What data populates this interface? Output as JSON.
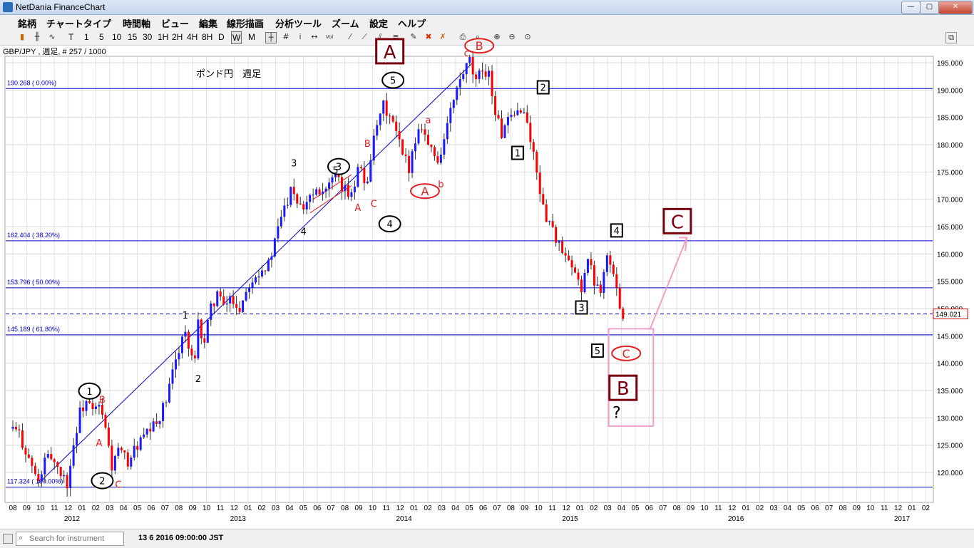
{
  "window": {
    "title": "NetDania FinanceChart",
    "min_label": "—",
    "max_label": "▢",
    "close_label": "✕"
  },
  "menu": [
    "銘柄",
    "チャートタイプ",
    "時間軸",
    "ビュー",
    "編集",
    "線形描画",
    "分析ツール",
    "ズーム",
    "設定",
    "ヘルプ"
  ],
  "toolbar": {
    "periods": [
      "T",
      "1",
      "5",
      "10",
      "15",
      "30",
      "1H",
      "2H",
      "4H",
      "8H",
      "D",
      "W",
      "M"
    ],
    "selected_period": "W"
  },
  "symbol_info": "GBP/JPY , 週足, # 257 / 1000",
  "status": {
    "search_placeholder": "Search for instrument",
    "time": "13 6 2016 09:00:00 JST"
  },
  "colors": {
    "up": "#1a1aff",
    "down": "#ff0000",
    "fib_line": "#0000cc",
    "wave_red": "#e02020",
    "box_dark": "#7a0010",
    "pink": "#f0a0c8"
  },
  "chart_data": {
    "type": "candlestick",
    "title": "ポンド円　週足",
    "instrument": "GBP/JPY",
    "interval": "weekly",
    "ylim": [
      116,
      197
    ],
    "y_ticks": [
      "120.000",
      "125.000",
      "130.000",
      "135.000",
      "140.000",
      "145.000",
      "150.000",
      "155.000",
      "160.000",
      "165.000",
      "170.000",
      "175.000",
      "180.000",
      "185.000",
      "190.000",
      "195.000"
    ],
    "x_months": [
      "08",
      "09",
      "10",
      "11",
      "12",
      "01",
      "02",
      "03",
      "04",
      "05",
      "06",
      "07",
      "08",
      "09",
      "10",
      "11",
      "12",
      "01",
      "02",
      "03",
      "04",
      "05",
      "06",
      "07",
      "08",
      "09",
      "10",
      "11",
      "12",
      "01",
      "02",
      "03",
      "04",
      "05",
      "06",
      "07",
      "08",
      "09",
      "10",
      "11",
      "12",
      "01",
      "02",
      "03",
      "04",
      "05",
      "06",
      "07",
      "08",
      "09",
      "10",
      "11",
      "12",
      "01",
      "02",
      "03",
      "04",
      "05",
      "06",
      "07",
      "08",
      "09",
      "10",
      "11",
      "12",
      "01",
      "02"
    ],
    "x_years": [
      "2012",
      "2013",
      "2014",
      "2015",
      "2016",
      "2017"
    ],
    "x_year_month_index": [
      5,
      17,
      29,
      41,
      53,
      65
    ],
    "last_price": "149.021",
    "path": [
      [
        0,
        128
      ],
      [
        2,
        127
      ],
      [
        4,
        124
      ],
      [
        6,
        121
      ],
      [
        8,
        118
      ],
      [
        10,
        122
      ],
      [
        12,
        123
      ],
      [
        15,
        120
      ],
      [
        17,
        118
      ],
      [
        19,
        125
      ],
      [
        21,
        131
      ],
      [
        23,
        133
      ],
      [
        25,
        131
      ],
      [
        27,
        132
      ],
      [
        29,
        128
      ],
      [
        31,
        121
      ],
      [
        33,
        124
      ],
      [
        36,
        122
      ],
      [
        39,
        125
      ],
      [
        42,
        127
      ],
      [
        45,
        129
      ],
      [
        48,
        133
      ],
      [
        50,
        138
      ],
      [
        52,
        143
      ],
      [
        54,
        146
      ],
      [
        55,
        142
      ],
      [
        57,
        140
      ],
      [
        58,
        147
      ],
      [
        60,
        144
      ],
      [
        62,
        150
      ],
      [
        64,
        153
      ],
      [
        66,
        150
      ],
      [
        68,
        152
      ],
      [
        71,
        150
      ],
      [
        74,
        155
      ],
      [
        77,
        157
      ],
      [
        80,
        158
      ],
      [
        82,
        162
      ],
      [
        84,
        167
      ],
      [
        86,
        170
      ],
      [
        87,
        173
      ],
      [
        89,
        170
      ],
      [
        91,
        169
      ],
      [
        93,
        171
      ],
      [
        95,
        172
      ],
      [
        98,
        172
      ],
      [
        101,
        174
      ],
      [
        103,
        172
      ],
      [
        105,
        171
      ],
      [
        107,
        173
      ],
      [
        108,
        177
      ],
      [
        110,
        173
      ],
      [
        111,
        174
      ],
      [
        112,
        178
      ],
      [
        114,
        183
      ],
      [
        116,
        187
      ],
      [
        118,
        185
      ],
      [
        120,
        182
      ],
      [
        122,
        178
      ],
      [
        124,
        176
      ],
      [
        126,
        181
      ],
      [
        128,
        184
      ],
      [
        130,
        180
      ],
      [
        133,
        177
      ],
      [
        135,
        181
      ],
      [
        137,
        186
      ],
      [
        139,
        190
      ],
      [
        141,
        193
      ],
      [
        143,
        195
      ],
      [
        145,
        191
      ],
      [
        147,
        194
      ],
      [
        149,
        193
      ],
      [
        151,
        186
      ],
      [
        153,
        182
      ],
      [
        155,
        184
      ],
      [
        157,
        185
      ],
      [
        159,
        187
      ],
      [
        161,
        184
      ],
      [
        163,
        178
      ],
      [
        165,
        172
      ],
      [
        166,
        168
      ],
      [
        168,
        166
      ],
      [
        170,
        163
      ],
      [
        172,
        160
      ],
      [
        174,
        158
      ],
      [
        176,
        156
      ],
      [
        178,
        154
      ],
      [
        180,
        159
      ],
      [
        182,
        155
      ],
      [
        184,
        154
      ],
      [
        186,
        160
      ],
      [
        188,
        156
      ],
      [
        189,
        153
      ],
      [
        190,
        151
      ],
      [
        191,
        149
      ]
    ],
    "fib_levels": [
      {
        "label": "190.268 ( 0.00%)",
        "value": 190.268
      },
      {
        "label": "162.404 ( 38.20%)",
        "value": 162.404
      },
      {
        "label": "153.796 ( 50.00%)",
        "value": 153.796
      },
      {
        "label": "145.189 ( 61.80%)",
        "value": 145.189
      },
      {
        "label": "117.324 ( 100.00%)",
        "value": 117.324
      }
    ],
    "annotations": {
      "wave_circles": [
        {
          "text": "1",
          "x": 24,
          "y": 134.9
        },
        {
          "text": "2",
          "x": 28,
          "y": 118.5
        },
        {
          "text": "3",
          "x": 102,
          "y": 176
        },
        {
          "text": "4",
          "x": 118,
          "y": 165.5
        },
        {
          "text": "5",
          "x": 119,
          "y": 191.8
        }
      ],
      "wave_boxes": [
        {
          "text": "1",
          "x": 158,
          "y": 178.5
        },
        {
          "text": "2",
          "x": 166,
          "y": 190.5
        },
        {
          "text": "3",
          "x": 178,
          "y": 150.2
        },
        {
          "text": "4",
          "x": 189,
          "y": 164.3
        },
        {
          "text": "5",
          "x": 183,
          "y": 142.3
        }
      ],
      "red_ovals": [
        {
          "text": "A",
          "x": 129,
          "y": 171.5
        },
        {
          "text": "B",
          "x": 146,
          "y": 198.1
        },
        {
          "text": "C",
          "x": 192,
          "y": 141.8
        }
      ],
      "big_boxes": [
        {
          "text": "A",
          "x": 118,
          "y": 197.1
        },
        {
          "text": "B",
          "x": 191,
          "y": 135.5
        },
        {
          "text": "C",
          "x": 208,
          "y": 166
        }
      ],
      "black_labels": [
        {
          "text": "3",
          "x": 88,
          "y": 176
        },
        {
          "text": "4",
          "x": 91,
          "y": 163.5
        },
        {
          "text": "5",
          "x": 101,
          "y": 174.7
        },
        {
          "text": "1",
          "x": 54,
          "y": 148.2
        },
        {
          "text": "2",
          "x": 58,
          "y": 136.6
        },
        {
          "text": "?",
          "x": 189,
          "y": 130
        }
      ],
      "red_labels": [
        {
          "text": "B",
          "x": 28,
          "y": 132.7
        },
        {
          "text": "A",
          "x": 27,
          "y": 124.8
        },
        {
          "text": "C",
          "x": 33,
          "y": 117.2
        },
        {
          "text": "B",
          "x": 111,
          "y": 179.6
        },
        {
          "text": "A",
          "x": 108,
          "y": 167.9
        },
        {
          "text": "C",
          "x": 113,
          "y": 168.6
        },
        {
          "text": "a",
          "x": 130,
          "y": 183.9
        },
        {
          "text": "b",
          "x": 134,
          "y": 172.2
        },
        {
          "text": "c",
          "x": 142,
          "y": 196.2
        }
      ]
    }
  }
}
